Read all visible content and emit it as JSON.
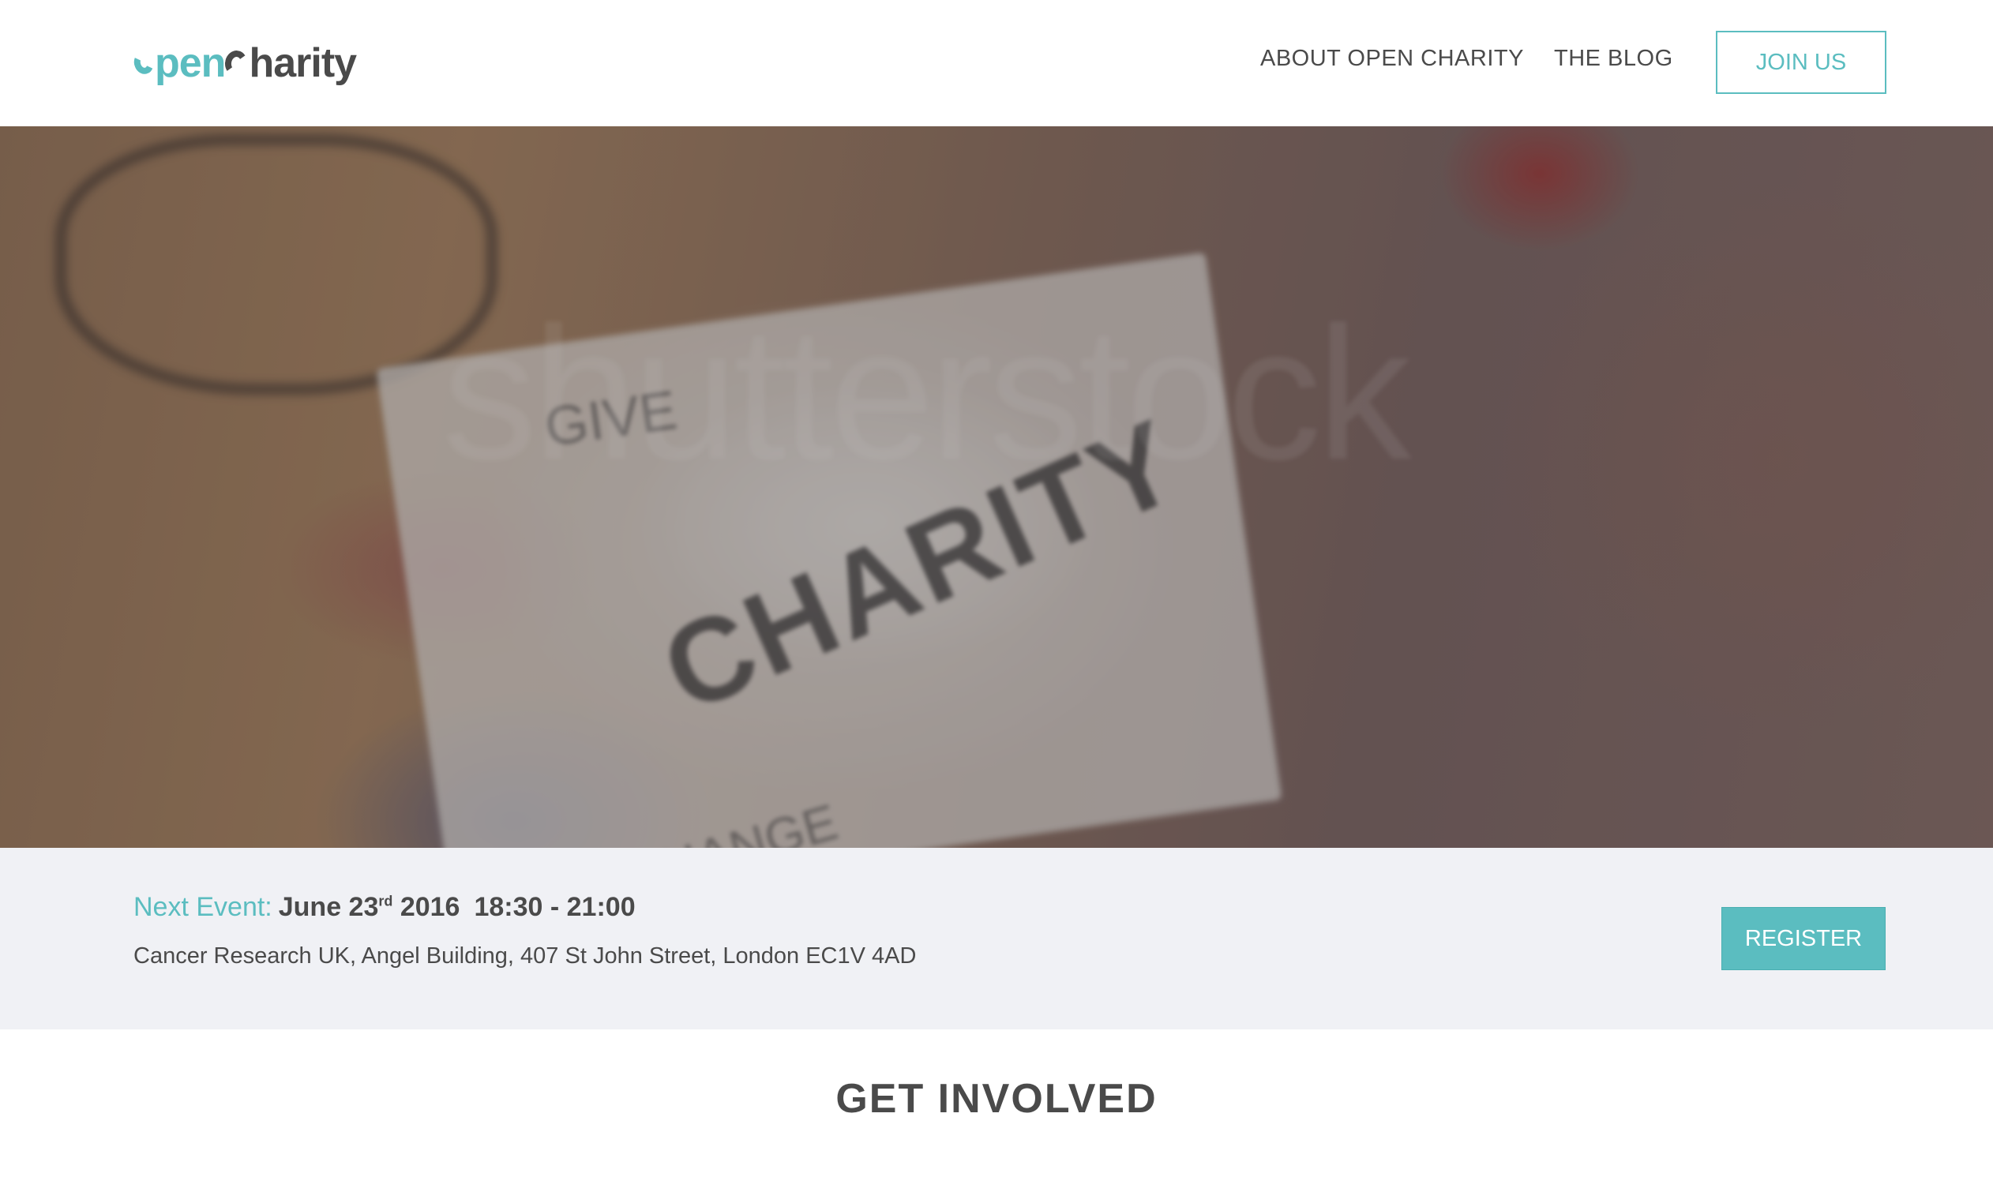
{
  "brand": {
    "logo_part1": "pen",
    "logo_part2": "harity",
    "accent_color": "#5bbdc0",
    "text_color": "#4a4a4a"
  },
  "nav": {
    "about": "ABOUT OPEN CHARITY",
    "blog": "THE BLOG",
    "join": "JOIN US"
  },
  "hero": {
    "notebook_words": [
      "GIVE",
      "CHARITY",
      "CHANGE"
    ],
    "watermark": "shutterstock"
  },
  "event": {
    "label": "Next Event:",
    "date_day": "June 23",
    "date_suffix": "rd",
    "date_year": "2016",
    "time": "18:30 - 21:00",
    "address": "Cancer Research UK, Angel Building, 407 St John Street, London EC1V 4AD",
    "register": "REGISTER"
  },
  "sections": {
    "get_involved_title": "GET INVOLVED"
  }
}
